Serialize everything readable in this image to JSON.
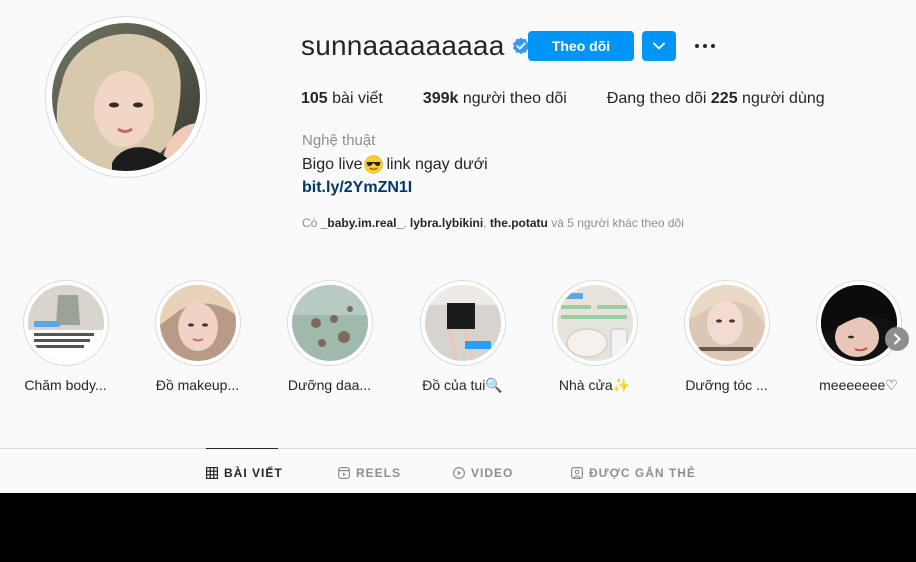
{
  "profile": {
    "username": "sunnaaaaaaaaa",
    "follow_label": "Theo dõi",
    "stats": {
      "posts_count": "105",
      "posts_label": " bài viết",
      "followers_count": "399k",
      "followers_label": " người theo dõi",
      "following_prefix": "Đang theo dõi ",
      "following_count": "225",
      "following_label": " người dùng"
    },
    "category": "Nghệ thuật",
    "bio_before": "Bigo live",
    "bio_after": " link ngay dưới",
    "link": "bit.ly/2YmZN1I",
    "followed_by": {
      "prefix": "Có ",
      "user1": "_baby.im.real_",
      "sep": ", ",
      "user2": "lybra.lybikini",
      "user3": "the.potatu",
      "suffix": " và 5 người khác theo dõi"
    }
  },
  "highlights": [
    {
      "label": "Chăm body..."
    },
    {
      "label": "Đồ makeup..."
    },
    {
      "label": "Dưỡng daa..."
    },
    {
      "label": "Đồ của tui🔍"
    },
    {
      "label": "Nhà cửa✨"
    },
    {
      "label": "Dưỡng tóc ..."
    },
    {
      "label": "meeeeeee♡"
    }
  ],
  "tabs": [
    {
      "label": "BÀI VIẾT",
      "icon": "grid-icon"
    },
    {
      "label": "REELS",
      "icon": "reels-icon"
    },
    {
      "label": "VIDEO",
      "icon": "play-icon"
    },
    {
      "label": "ĐƯỢC GẮN THẺ",
      "icon": "tag-icon"
    }
  ],
  "colors": {
    "accent": "#0095f6",
    "link": "#00376b",
    "muted": "#8e8e8e",
    "text": "#262626"
  }
}
